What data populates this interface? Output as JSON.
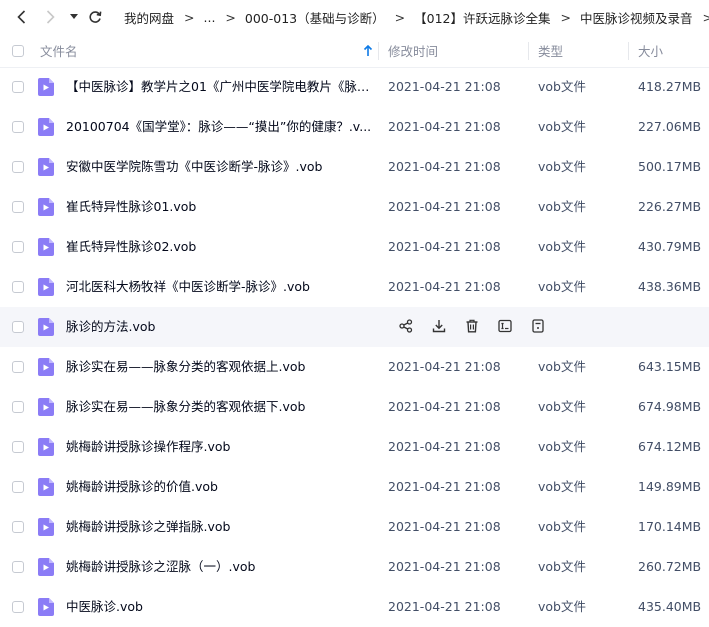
{
  "breadcrumb": {
    "items": [
      "我的网盘",
      "...",
      "000-013（基础与诊断）",
      "【012】许跃远脉诊全集",
      "中医脉诊视频及录音"
    ],
    "separator": ">"
  },
  "header": {
    "col_name": "文件名",
    "col_modified": "修改时间",
    "col_type": "类型",
    "col_size": "大小",
    "sort_icon": "sort-up-arrow-icon"
  },
  "hover_row_index": 6,
  "files": [
    {
      "name": "【中医脉诊】教学片之01《广州中医学院电教片《脉诊...",
      "modified": "2021-04-21 21:08",
      "type": "vob文件",
      "size": "418.27MB"
    },
    {
      "name": "20100704《国学堂》：脉诊——“摸出”你的健康？.v...",
      "modified": "2021-04-21 21:08",
      "type": "vob文件",
      "size": "227.06MB"
    },
    {
      "name": "安徽中医学院陈雪功《中医诊断学-脉诊》.vob",
      "modified": "2021-04-21 21:08",
      "type": "vob文件",
      "size": "500.17MB"
    },
    {
      "name": "崔氏特异性脉诊01.vob",
      "modified": "2021-04-21 21:08",
      "type": "vob文件",
      "size": "226.27MB"
    },
    {
      "name": "崔氏特异性脉诊02.vob",
      "modified": "2021-04-21 21:08",
      "type": "vob文件",
      "size": "430.79MB"
    },
    {
      "name": "河北医科大杨牧祥《中医诊断学-脉诊》.vob",
      "modified": "2021-04-21 21:08",
      "type": "vob文件",
      "size": "438.36MB"
    },
    {
      "name": "脉诊的方法.vob",
      "modified": "",
      "type": "",
      "size": ""
    },
    {
      "name": "脉诊实在易——脉象分类的客观依据上.vob",
      "modified": "2021-04-21 21:08",
      "type": "vob文件",
      "size": "643.15MB"
    },
    {
      "name": "脉诊实在易——脉象分类的客观依据下.vob",
      "modified": "2021-04-21 21:08",
      "type": "vob文件",
      "size": "674.98MB"
    },
    {
      "name": "姚梅龄讲授脉诊操作程序.vob",
      "modified": "2021-04-21 21:08",
      "type": "vob文件",
      "size": "674.12MB"
    },
    {
      "name": "姚梅龄讲授脉诊的价值.vob",
      "modified": "2021-04-21 21:08",
      "type": "vob文件",
      "size": "149.89MB"
    },
    {
      "name": "姚梅龄讲授脉诊之弹指脉.vob",
      "modified": "2021-04-21 21:08",
      "type": "vob文件",
      "size": "170.14MB"
    },
    {
      "name": "姚梅龄讲授脉诊之涩脉（一）.vob",
      "modified": "2021-04-21 21:08",
      "type": "vob文件",
      "size": "260.72MB"
    },
    {
      "name": "中医脉诊.vob",
      "modified": "2021-04-21 21:08",
      "type": "vob文件",
      "size": "435.40MB"
    }
  ],
  "row_actions": [
    "share-icon",
    "download-icon",
    "delete-icon",
    "rename-icon",
    "more-icon"
  ],
  "colors": {
    "file_icon": "#8b7cf6",
    "hover_bg": "#f5f6fa",
    "sort_accent": "#0e7ae6"
  }
}
